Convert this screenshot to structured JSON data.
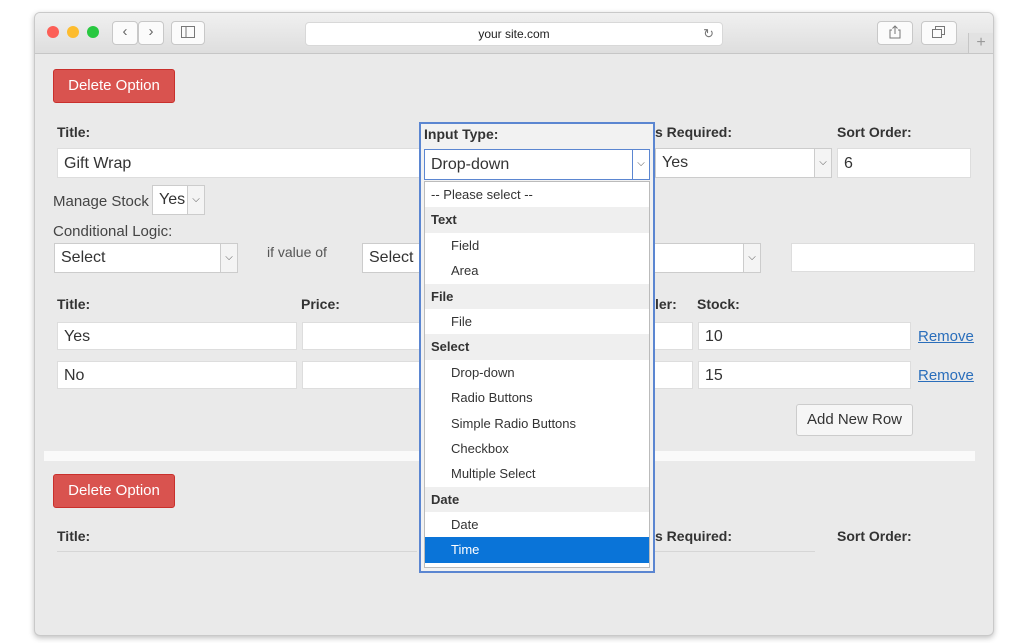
{
  "browser": {
    "url": "your site.com"
  },
  "section1": {
    "delete_button": "Delete Option",
    "title_label": "Title:",
    "title_value": "Gift Wrap",
    "input_type_label": "Input Type:",
    "is_required_label": "s Required:",
    "is_required_value": "Yes",
    "sort_order_label": "Sort Order:",
    "sort_order_value": "6",
    "manage_stock_label": "Manage Stock",
    "manage_stock_value": "Yes",
    "conditional_logic_label": "Conditional Logic:",
    "conditional_select": "Select",
    "if_value_of": "if value of",
    "value_select": "Select"
  },
  "rows_table": {
    "headers": {
      "title": "Title:",
      "price": "Price:",
      "order": "ler:",
      "stock": "Stock:"
    },
    "rows": [
      {
        "title": "Yes",
        "stock": "10",
        "remove": "Remove"
      },
      {
        "title": "No",
        "stock": "15",
        "remove": "Remove"
      }
    ],
    "add_row_button": "Add New Row"
  },
  "section2": {
    "delete_button": "Delete Option",
    "title_label": "Title:",
    "is_required_label": "s Required:",
    "sort_order_label": "Sort Order:"
  },
  "dropdown": {
    "selected_value": "Drop-down",
    "placeholder": "-- Please select --",
    "groups": [
      {
        "label": "Text",
        "options": [
          "Field",
          "Area"
        ]
      },
      {
        "label": "File",
        "options": [
          "File"
        ]
      },
      {
        "label": "Select",
        "options": [
          "Drop-down",
          "Radio Buttons",
          "Simple Radio Buttons",
          "Checkbox",
          "Multiple Select"
        ]
      },
      {
        "label": "Date",
        "options": [
          "Date",
          "Time"
        ]
      }
    ],
    "highlighted": "Time"
  },
  "colors": {
    "danger": "#d9534f",
    "highlight": "#0a74d8",
    "focus_border": "#5b86d1",
    "link": "#2a6ebb"
  }
}
